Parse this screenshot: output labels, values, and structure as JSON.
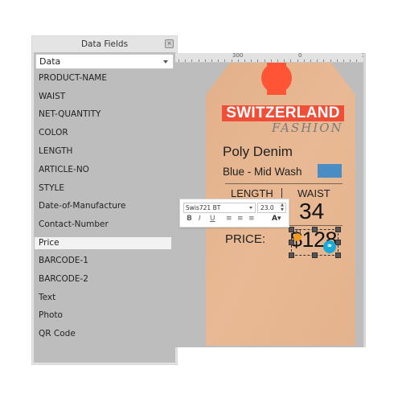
{
  "panel": {
    "title": "Data Fields",
    "close_icon": "close-icon",
    "dropdown": {
      "selected": "Data"
    },
    "items": [
      {
        "label": "PRODUCT-NAME",
        "selected": false
      },
      {
        "label": "WAIST",
        "selected": false
      },
      {
        "label": "NET-QUANTITY",
        "selected": false
      },
      {
        "label": "COLOR",
        "selected": false
      },
      {
        "label": "LENGTH",
        "selected": false
      },
      {
        "label": "ARTICLE-NO",
        "selected": false
      },
      {
        "label": "STYLE",
        "selected": false
      },
      {
        "label": "Date-of-Manufacture",
        "selected": false
      },
      {
        "label": "Contact-Number",
        "selected": false
      },
      {
        "label": "Price",
        "selected": true
      },
      {
        "label": "BARCODE-1",
        "selected": false
      },
      {
        "label": "BARCODE-2",
        "selected": false
      },
      {
        "label": "Text",
        "selected": false
      },
      {
        "label": "Photo",
        "selected": false
      },
      {
        "label": "QR Code",
        "selected": false
      }
    ]
  },
  "ruler": {
    "labels": [
      "300",
      "0",
      "3"
    ]
  },
  "toolbar": {
    "font": "Swis721 BT",
    "size": "23.0",
    "bold": "B",
    "italic": "I",
    "underline": "U",
    "align_left": "≡",
    "align_center": "≡",
    "align_right": "≡",
    "text_color": "A▾"
  },
  "tag": {
    "brand": "SWITZERLAND",
    "brand_sub": "FASHION",
    "product": "Poly Denim",
    "color": "Blue - Mid Wash",
    "length_label": "LENGTH",
    "waist_label": "WAIST",
    "waist_value": "34",
    "price_label": "PRICE:",
    "price_value": "$128",
    "colors": {
      "brand_red": "#f04e37",
      "swatch": "#4a8dc4",
      "kraft": "#e5b48e"
    }
  }
}
